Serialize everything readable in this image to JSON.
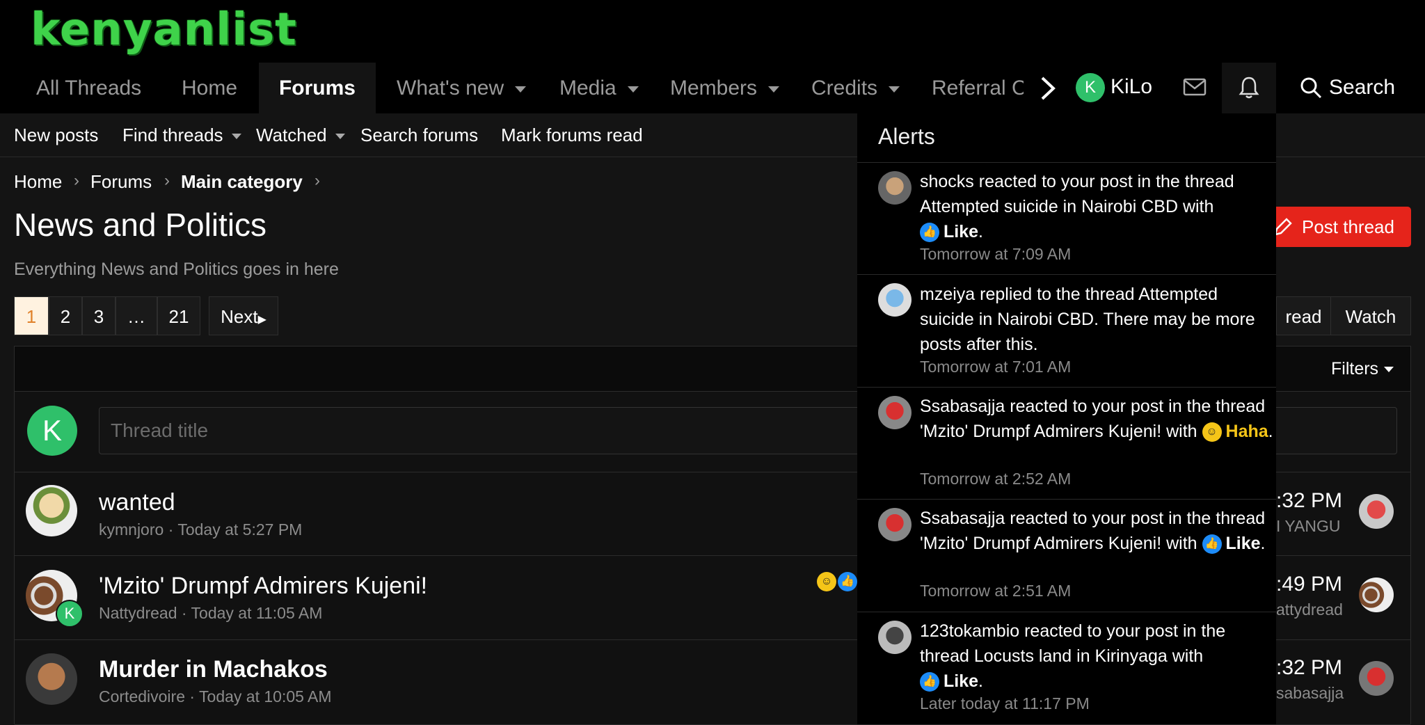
{
  "logo": "kenyanlist",
  "nav": {
    "tabs": [
      "All Threads",
      "Home",
      "Forums",
      "What's new",
      "Media",
      "Members",
      "Credits",
      "Referral C"
    ],
    "user_initial": "K",
    "username": "KiLo",
    "search_label": "Search"
  },
  "subnav": [
    "New posts",
    "Find threads",
    "Watched",
    "Search forums",
    "Mark forums read"
  ],
  "breadcrumb": [
    "Home",
    "Forums",
    "Main category"
  ],
  "page": {
    "title": "News and Politics",
    "description": "Everything News and Politics goes in here",
    "post_thread": "Post thread",
    "mark_read": "read",
    "watch": "Watch",
    "filters": "Filters"
  },
  "pagination": [
    "1",
    "2",
    "3",
    "…",
    "21",
    "Next"
  ],
  "new_thread": {
    "initial": "K",
    "placeholder": "Thread title"
  },
  "threads": [
    {
      "title": "wanted",
      "author": "kymnjoro",
      "date": "Today at 5:27 PM",
      "last_time": ":32 PM",
      "last_user": "I YANGU"
    },
    {
      "title": "'Mzito' Drumpf Admirers Kujeni!",
      "author": "Nattydread",
      "date": "Today at 11:05 AM",
      "last_time": ":49 PM",
      "last_user": "attydread",
      "badge": "K"
    },
    {
      "title": "Murder in Machakos",
      "author": "Cortedivoire",
      "date": "Today at 10:05 AM",
      "last_time": ":32 PM",
      "last_user": "sabasajja"
    }
  ],
  "alerts": {
    "title": "Alerts",
    "items": [
      {
        "text": "shocks reacted to your post in the thread Attempted suicide in Nairobi CBD with",
        "reaction": "Like",
        "time": "Tomorrow at 7:09 AM"
      },
      {
        "text": "mzeiya replied to the thread Attempted suicide in Nairobi CBD. There may be more posts after this.",
        "reaction": "",
        "time": "Tomorrow at 7:01 AM"
      },
      {
        "text": "Ssabasajja reacted to your post in the thread 'Mzito' Drumpf Admirers Kujeni! with",
        "reaction": "Haha",
        "time": "Tomorrow at 2:52 AM"
      },
      {
        "text": "Ssabasajja reacted to your post in the thread 'Mzito' Drumpf Admirers Kujeni! with",
        "reaction": "Like",
        "time": "Tomorrow at 2:51 AM"
      },
      {
        "text": "123tokambio reacted to your post in the thread Locusts land in Kirinyaga with",
        "reaction": "Like",
        "time": "Later today at 11:17 PM"
      }
    ]
  },
  "colors": {
    "accent_red": "#e5241b",
    "logo_green": "#3fd24a",
    "avatar_green": "#2fc06a",
    "like_blue": "#1d8cf8",
    "haha_yellow": "#f5c518",
    "page_current": "#e0812b"
  },
  "icons": {
    "chevron": "chevron-right-icon",
    "mail": "envelope-icon",
    "bell": "bell-icon",
    "search": "search-icon",
    "post": "pencil-icon"
  }
}
